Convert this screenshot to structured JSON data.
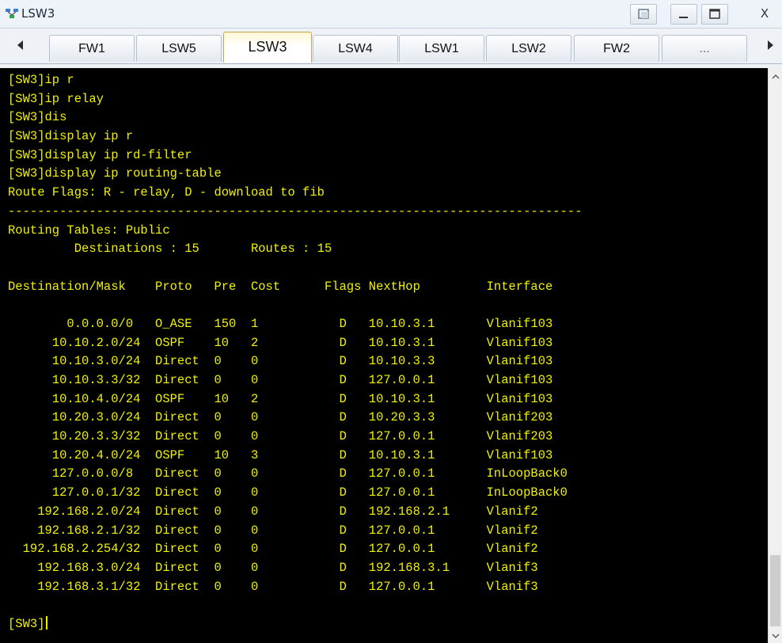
{
  "window": {
    "title": "LSW3",
    "close_label": "X"
  },
  "tabs": [
    {
      "label": "FW1",
      "active": false
    },
    {
      "label": "LSW5",
      "active": false
    },
    {
      "label": "LSW3",
      "active": true
    },
    {
      "label": "LSW4",
      "active": false
    },
    {
      "label": "LSW1",
      "active": false
    },
    {
      "label": "LSW2",
      "active": false
    },
    {
      "label": "FW2",
      "active": false
    },
    {
      "label": "...",
      "active": false
    }
  ],
  "terminal": {
    "lines": [
      "[SW3]ip r",
      "[SW3]ip relay",
      "[SW3]dis",
      "[SW3]display ip r",
      "[SW3]display ip rd-filter",
      "[SW3]display ip routing-table",
      "Route Flags: R - relay, D - download to fib",
      "------------------------------------------------------------------------------",
      "Routing Tables: Public",
      "         Destinations : 15       Routes : 15",
      "",
      "Destination/Mask    Proto   Pre  Cost      Flags NextHop         Interface",
      "",
      "        0.0.0.0/0   O_ASE   150  1           D   10.10.3.1       Vlanif103",
      "      10.10.2.0/24  OSPF    10   2           D   10.10.3.1       Vlanif103",
      "      10.10.3.0/24  Direct  0    0           D   10.10.3.3       Vlanif103",
      "      10.10.3.3/32  Direct  0    0           D   127.0.0.1       Vlanif103",
      "      10.10.4.0/24  OSPF    10   2           D   10.10.3.1       Vlanif103",
      "      10.20.3.0/24  Direct  0    0           D   10.20.3.3       Vlanif203",
      "      10.20.3.3/32  Direct  0    0           D   127.0.0.1       Vlanif203",
      "      10.20.4.0/24  OSPF    10   3           D   10.10.3.1       Vlanif103",
      "      127.0.0.0/8   Direct  0    0           D   127.0.0.1       InLoopBack0",
      "      127.0.0.1/32  Direct  0    0           D   127.0.0.1       InLoopBack0",
      "    192.168.2.0/24  Direct  0    0           D   192.168.2.1     Vlanif2",
      "    192.168.2.1/32  Direct  0    0           D   127.0.0.1       Vlanif2",
      "  192.168.2.254/32  Direct  0    0           D   127.0.0.1       Vlanif2",
      "    192.168.3.0/24  Direct  0    0           D   192.168.3.1     Vlanif3",
      "    192.168.3.1/32  Direct  0    0           D   127.0.0.1       Vlanif3",
      ""
    ],
    "prompt": "[SW3]",
    "text_color": "#f1f100",
    "background_color": "#000000"
  },
  "icons": {
    "app": "topology-icon",
    "restore": "restore-icon",
    "minimize": "minimize-icon",
    "maximize": "maximize-icon",
    "close": "close-icon",
    "tab_prev": "arrow-left-icon",
    "tab_next": "arrow-right-icon"
  }
}
